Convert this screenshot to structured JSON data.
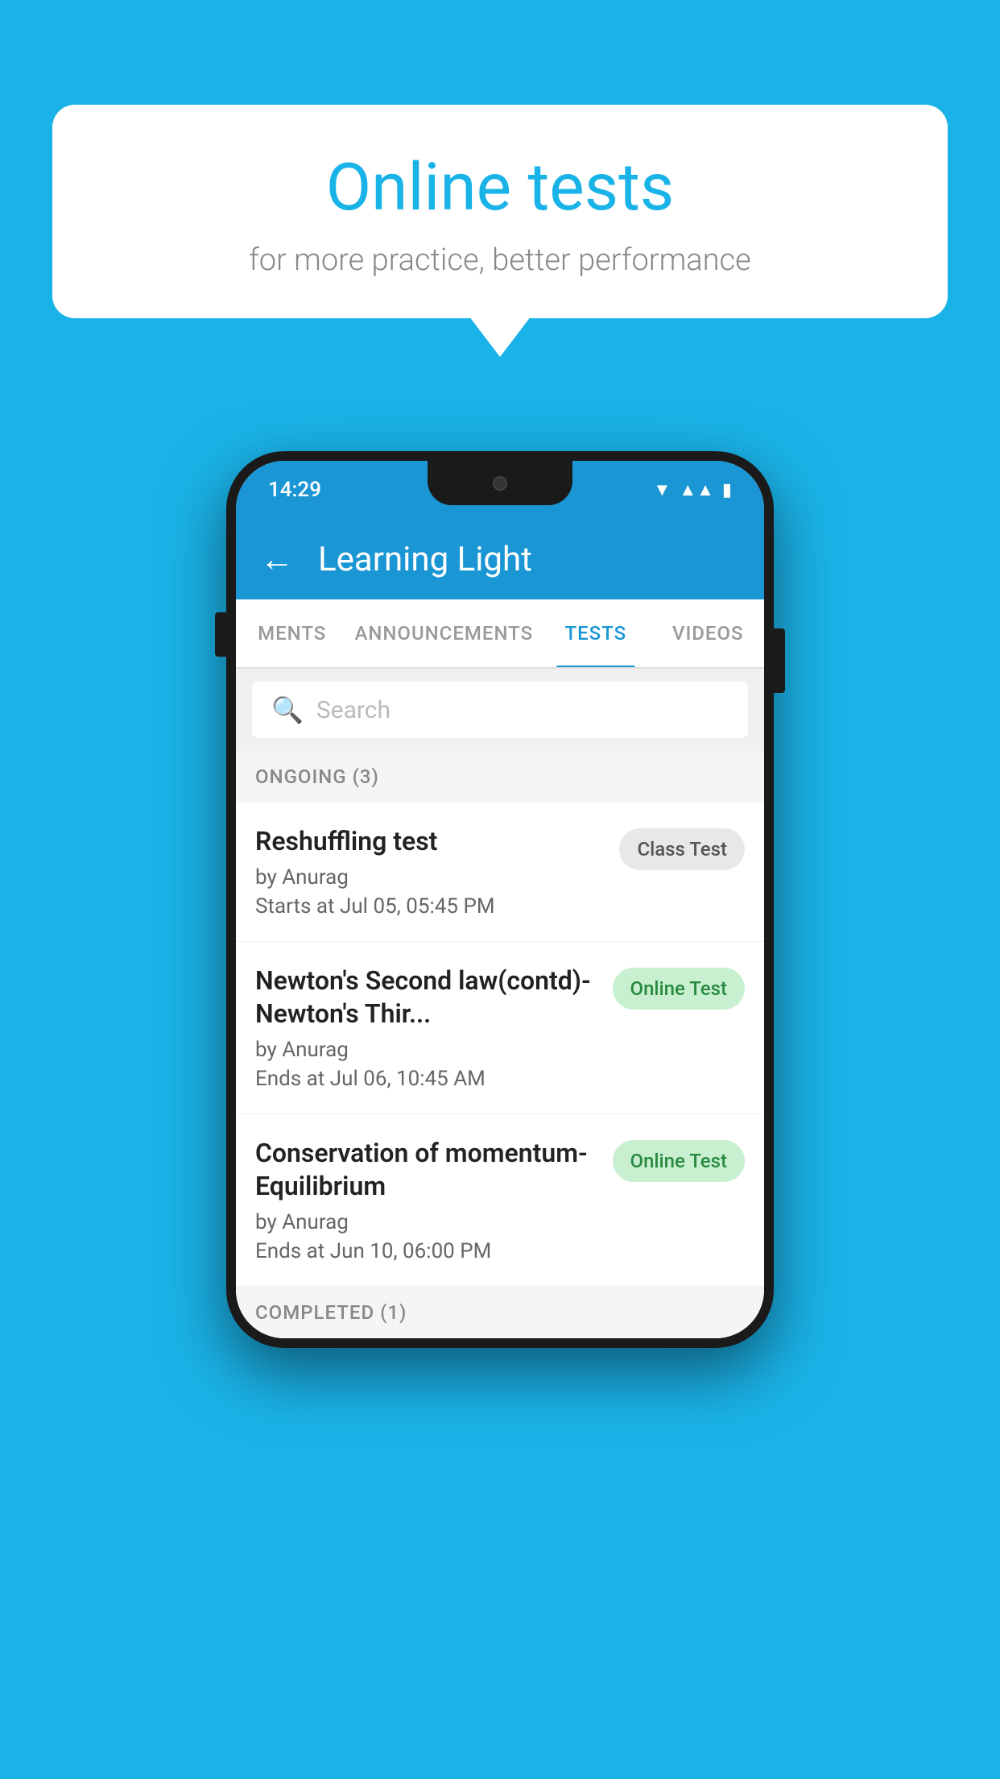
{
  "background_color": "#1ab3e8",
  "bubble": {
    "title": "Online tests",
    "subtitle": "for more practice, better performance"
  },
  "phone": {
    "status_bar": {
      "time": "14:29"
    },
    "app_bar": {
      "title": "Learning Light",
      "back_label": "←"
    },
    "tabs": [
      {
        "label": "MENTS",
        "active": false
      },
      {
        "label": "ANNOUNCEMENTS",
        "active": false
      },
      {
        "label": "TESTS",
        "active": true
      },
      {
        "label": "VIDEOS",
        "active": false
      }
    ],
    "search": {
      "placeholder": "Search"
    },
    "sections": [
      {
        "header": "ONGOING (3)",
        "tests": [
          {
            "title": "Reshuffling test",
            "by": "by Anurag",
            "time": "Starts at  Jul 05, 05:45 PM",
            "tag": "Class Test",
            "tag_type": "class"
          },
          {
            "title": "Newton's Second law(contd)-Newton's Thir...",
            "by": "by Anurag",
            "time": "Ends at  Jul 06, 10:45 AM",
            "tag": "Online Test",
            "tag_type": "online"
          },
          {
            "title": "Conservation of momentum-Equilibrium",
            "by": "by Anurag",
            "time": "Ends at  Jun 10, 06:00 PM",
            "tag": "Online Test",
            "tag_type": "online"
          }
        ]
      }
    ],
    "completed_header": "COMPLETED (1)"
  }
}
